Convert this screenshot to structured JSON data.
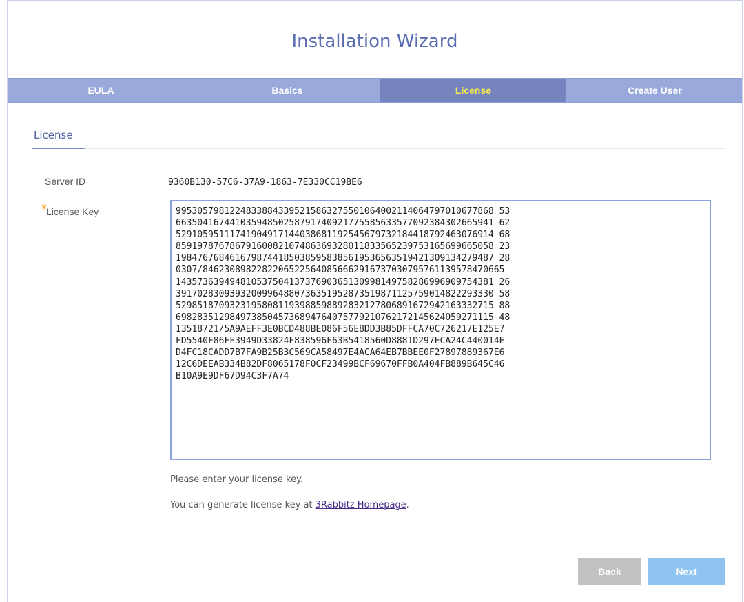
{
  "header": {
    "title": "Installation Wizard"
  },
  "tabs": [
    {
      "label": "EULA",
      "active": false
    },
    {
      "label": "Basics",
      "active": false
    },
    {
      "label": "License",
      "active": true
    },
    {
      "label": "Create User",
      "active": false
    }
  ],
  "section": {
    "title": "License"
  },
  "form": {
    "server_id_label": "Server ID",
    "server_id_value": "9360B130-57C6-37A9-1863-7E330CC19BE6",
    "required_marker": "*",
    "license_key_label": "License Key",
    "license_key_value": "99530579812248338843395215863275501064002114064797010677868 53\n66350416744103594850258791740921775585633577092384302665941 62\n52910595111741904917144038681192545679732184418792463076914 68\n85919787678679160082107486369328011833565239753165699665058 23\n19847676846167987441850385958385619536563519421309134279487 28\n0307/84623089822822065225640856662916737030795761139578470665\n14357363949481053750413737690365130998149758286996909754381 26\n39170283093932009964880736351952873519871125759014822293330 58\n52985187093231958081193988598892832127806891672942163332715 88\n69828351298497385045736894764075779210762172145624059271115 48\n13518721/5A9AEFF3E0BCD488BE086F56E8DD3B85DFFCA70C726217E125E7\nFD5540F86FF3949D33824F838596F63B5418560D8881D297ECA24C440014E\nD4FC18CADD7B7FA9B25B3C569CA58497E4ACA64EB7BBEE0F27897889367E6\n12C6DEEAB334B82DF8065178F0CF23499BCF69670FFB0A404FB889B645C46\nB10A9E9DF67D94C3F7A74"
  },
  "hints": {
    "enter_key": "Please enter your license key.",
    "generate_prefix": "You can generate license key at ",
    "generate_link": "3Rabbitz Homepage",
    "generate_suffix": "."
  },
  "buttons": {
    "back_label": "Back",
    "next_label": "Next"
  },
  "colors": {
    "accent": "#5a6db3",
    "tab_bar": "#99a9dc",
    "tab_active": "#7583be",
    "tab_active_text": "#f6ec4f",
    "next_button": "#8fc3f0",
    "back_button": "#c2c2c2"
  }
}
